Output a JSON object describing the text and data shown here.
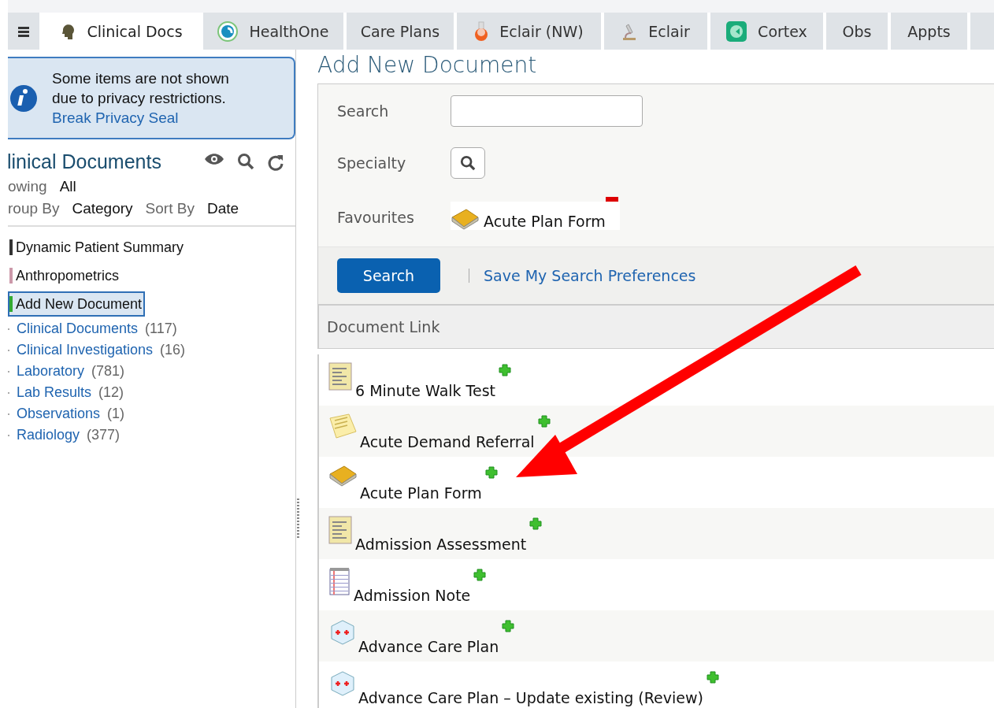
{
  "tabs": [
    {
      "kind": "menu",
      "selected": false
    },
    {
      "kind": "head",
      "label": "Clinical Docs",
      "selected": true
    },
    {
      "kind": "healthone",
      "label": "HealthOne",
      "selected": false
    },
    {
      "kind": "plain",
      "label": "Care Plans",
      "selected": false
    },
    {
      "kind": "flask",
      "label": "Eclair (NW)",
      "selected": false
    },
    {
      "kind": "microscope",
      "label": "Eclair",
      "selected": false
    },
    {
      "kind": "cortex",
      "label": "Cortex",
      "selected": false
    },
    {
      "kind": "plain",
      "label": "Obs",
      "selected": false
    },
    {
      "kind": "plain",
      "label": "Appts",
      "selected": false
    },
    {
      "kind": "plain",
      "selected": false
    }
  ],
  "privacy_notice": {
    "message": "Some items are not shown due to privacy restrictions.",
    "link": "Break Privacy Seal"
  },
  "sidebar": {
    "title": "linical Documents",
    "filters": [
      {
        "label": "owing",
        "value": "All"
      },
      {
        "label": "roup By",
        "value": "Category",
        "label2": "Sort By",
        "value2": "Date"
      }
    ],
    "items": [
      {
        "kind": "summary",
        "label": "Dynamic Patient Summary",
        "selected": false
      },
      {
        "kind": "chart",
        "label": "Anthropometrics",
        "selected": false
      },
      {
        "kind": "add",
        "label": "Add New Document",
        "selected": true,
        "children": [
          {
            "label": "Clinical Documents",
            "count": "(117)"
          },
          {
            "label": "Clinical Investigations",
            "count": "(16)"
          },
          {
            "label": "Laboratory",
            "count": "(781)"
          },
          {
            "label": "Lab Results",
            "count": "(12)"
          },
          {
            "label": "Observations",
            "count": "(1)"
          },
          {
            "label": "Radiology",
            "count": "(377)"
          }
        ]
      }
    ]
  },
  "main": {
    "title": "Add New Document",
    "form": {
      "search_label": "Search",
      "specialty_label": "Specialty",
      "favourites_label": "Favourites",
      "favourite": "Acute Plan Form",
      "search_button": "Search",
      "save_link": "Save My Search Preferences"
    },
    "table": {
      "column": "Document Link",
      "rows": [
        {
          "kind": "form",
          "label": "6 Minute Walk Test"
        },
        {
          "kind": "note",
          "label": "Acute Demand Referral"
        },
        {
          "kind": "book",
          "label": "Acute Plan Form"
        },
        {
          "kind": "form",
          "label": "Admission Assessment"
        },
        {
          "kind": "notebook",
          "label": "Admission Note"
        },
        {
          "kind": "kit",
          "label": "Advance Care Plan"
        },
        {
          "kind": "kit",
          "label": "Advance Care Plan – Update existing (Review)"
        }
      ]
    }
  }
}
